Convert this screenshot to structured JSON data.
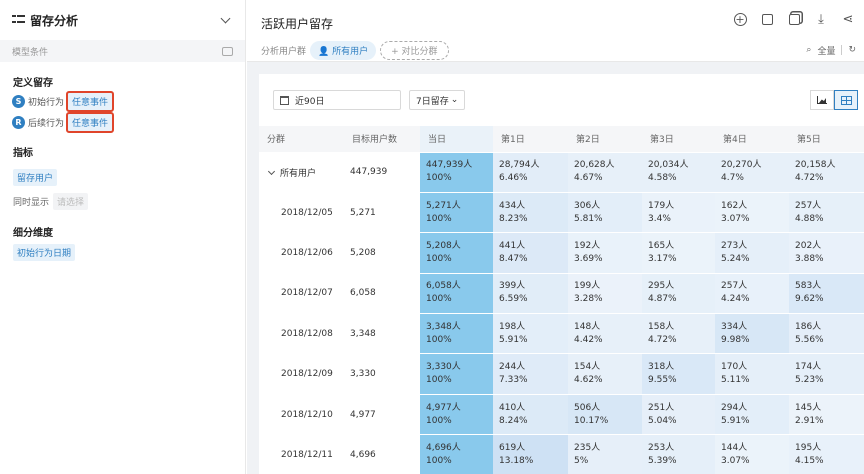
{
  "sidebar": {
    "title": "留存分析",
    "model_condition": "模型条件",
    "define_retention": "定义留存",
    "initial": {
      "badge": "S",
      "label": "初始行为",
      "event": "任意事件"
    },
    "subsequent": {
      "badge": "R",
      "label": "后续行为",
      "event": "任意事件"
    },
    "metric_title": "指标",
    "metric_tag": "留存用户",
    "show_label": "同时显示",
    "show_placeholder": "请选择",
    "dimension_title": "细分维度",
    "dimension_tag": "初始行为日期"
  },
  "header": {
    "title": "活跃用户留存",
    "group_label": "分析用户群",
    "group_active": "所有用户",
    "compare_label": "+ 对比分群",
    "search_label": "全量"
  },
  "toolbar": {
    "date_range": "近90日",
    "retention_type": "7日留存",
    "view_mode_selected": "table"
  },
  "table": {
    "columns": [
      "分群",
      "目标用户数",
      "当日",
      "第1日",
      "第2日",
      "第3日",
      "第4日",
      "第5日"
    ],
    "rows": [
      {
        "group": "所有用户",
        "expanded": true,
        "target": "447,939",
        "cells": [
          [
            "447,939人",
            "100%"
          ],
          [
            "28,794人",
            "6.46%"
          ],
          [
            "20,628人",
            "4.67%"
          ],
          [
            "20,034人",
            "4.58%"
          ],
          [
            "20,270人",
            "4.7%"
          ],
          [
            "20,158人",
            "4.72%"
          ]
        ]
      },
      {
        "group": "2018/12/05",
        "target": "5,271",
        "cells": [
          [
            "5,271人",
            "100%"
          ],
          [
            "434人",
            "8.23%"
          ],
          [
            "306人",
            "5.81%"
          ],
          [
            "179人",
            "3.4%"
          ],
          [
            "162人",
            "3.07%"
          ],
          [
            "257人",
            "4.88%"
          ]
        ]
      },
      {
        "group": "2018/12/06",
        "target": "5,208",
        "cells": [
          [
            "5,208人",
            "100%"
          ],
          [
            "441人",
            "8.47%"
          ],
          [
            "192人",
            "3.69%"
          ],
          [
            "165人",
            "3.17%"
          ],
          [
            "273人",
            "5.24%"
          ],
          [
            "202人",
            "3.88%"
          ]
        ]
      },
      {
        "group": "2018/12/07",
        "target": "6,058",
        "cells": [
          [
            "6,058人",
            "100%"
          ],
          [
            "399人",
            "6.59%"
          ],
          [
            "199人",
            "3.28%"
          ],
          [
            "295人",
            "4.87%"
          ],
          [
            "257人",
            "4.24%"
          ],
          [
            "583人",
            "9.62%"
          ]
        ]
      },
      {
        "group": "2018/12/08",
        "target": "3,348",
        "cells": [
          [
            "3,348人",
            "100%"
          ],
          [
            "198人",
            "5.91%"
          ],
          [
            "148人",
            "4.42%"
          ],
          [
            "158人",
            "4.72%"
          ],
          [
            "334人",
            "9.98%"
          ],
          [
            "186人",
            "5.56%"
          ]
        ]
      },
      {
        "group": "2018/12/09",
        "target": "3,330",
        "cells": [
          [
            "3,330人",
            "100%"
          ],
          [
            "244人",
            "7.33%"
          ],
          [
            "154人",
            "4.62%"
          ],
          [
            "318人",
            "9.55%"
          ],
          [
            "170人",
            "5.11%"
          ],
          [
            "174人",
            "5.23%"
          ]
        ]
      },
      {
        "group": "2018/12/10",
        "target": "4,977",
        "cells": [
          [
            "4,977人",
            "100%"
          ],
          [
            "410人",
            "8.24%"
          ],
          [
            "506人",
            "10.17%"
          ],
          [
            "251人",
            "5.04%"
          ],
          [
            "294人",
            "5.91%"
          ],
          [
            "145人",
            "2.91%"
          ]
        ]
      },
      {
        "group": "2018/12/11",
        "target": "4,696",
        "cells": [
          [
            "4,696人",
            "100%"
          ],
          [
            "619人",
            "13.18%"
          ],
          [
            "235人",
            "5%"
          ],
          [
            "253人",
            "5.39%"
          ],
          [
            "144人",
            "3.07%"
          ],
          [
            "195人",
            "4.15%"
          ]
        ]
      }
    ]
  },
  "colors": {
    "accent": "#2f7fc1",
    "highlight_border": "#e0452b",
    "day0_cell": "#89c9ec"
  }
}
